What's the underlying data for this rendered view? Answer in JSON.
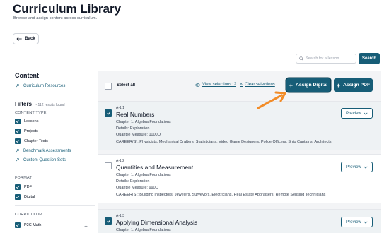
{
  "header": {
    "title": "Curriculum Library",
    "subtitle": "Browse and assign content across curriculum."
  },
  "back_button": {
    "label": "Back"
  },
  "search": {
    "placeholder": "Search for a lesson...",
    "button_label": "Search"
  },
  "sidebar": {
    "content_heading": "Content",
    "curriculum_resources": "Curriculum Resources",
    "filters_heading": "Filters",
    "results_count": "~ 112 results found",
    "content_type_label": "CONTENT TYPE",
    "content_types": [
      {
        "label": "Lessons",
        "checked": true
      },
      {
        "label": "Projects",
        "checked": true
      },
      {
        "label": "Chapter Tests",
        "checked": true
      }
    ],
    "links": [
      "Benchmark Assessments",
      "Custom Question Sets"
    ],
    "format_label": "FORMAT",
    "formats": [
      {
        "label": "PDF",
        "checked": true
      },
      {
        "label": "Digital",
        "checked": true
      }
    ],
    "curriculum_label": "CURRICULUM",
    "curricula": [
      {
        "label": "P2C Math",
        "checked": true
      }
    ]
  },
  "toolbar": {
    "select_all": "Select all",
    "view_selections": "View selections: 2",
    "clear_selections": "Clear selections",
    "assign_digital": "Assign Digital",
    "assign_pdf": "Assign PDF"
  },
  "cards": [
    {
      "code": "A-1.1",
      "title": "Real Numbers",
      "selected": true,
      "chapter": "Chapter 1: Algebra Foundations",
      "details": "Details: Exploration",
      "quantile": "Quantile Measure: 1000Q",
      "careers": "CAREER(S): Physicists, Mechanical Drafters, Statisticians, Video Game Designers, Police Officers, Ship Captains, Architects",
      "preview": "Preview"
    },
    {
      "code": "A-1.2",
      "title": "Quantities and Measurement",
      "selected": false,
      "chapter": "Chapter 1: Algebra Foundations",
      "details": "Details: Exploration",
      "quantile": "Quantile Measure: 990Q",
      "careers": "CAREER(S): Building Inspectors, Jewelers, Surveyors, Electricians, Real Estate Appraisers, Remote Sensing Technicians",
      "preview": "Preview"
    },
    {
      "code": "A-1.3",
      "title": "Applying Dimensional Analysis",
      "selected": true,
      "chapter": "Chapter 1: Algebra Foundations",
      "preview": "Preview"
    }
  ],
  "colors": {
    "brand": "#175d77",
    "annotation_arrow": "#f28c28",
    "panel_bg": "#f3f4f6"
  }
}
